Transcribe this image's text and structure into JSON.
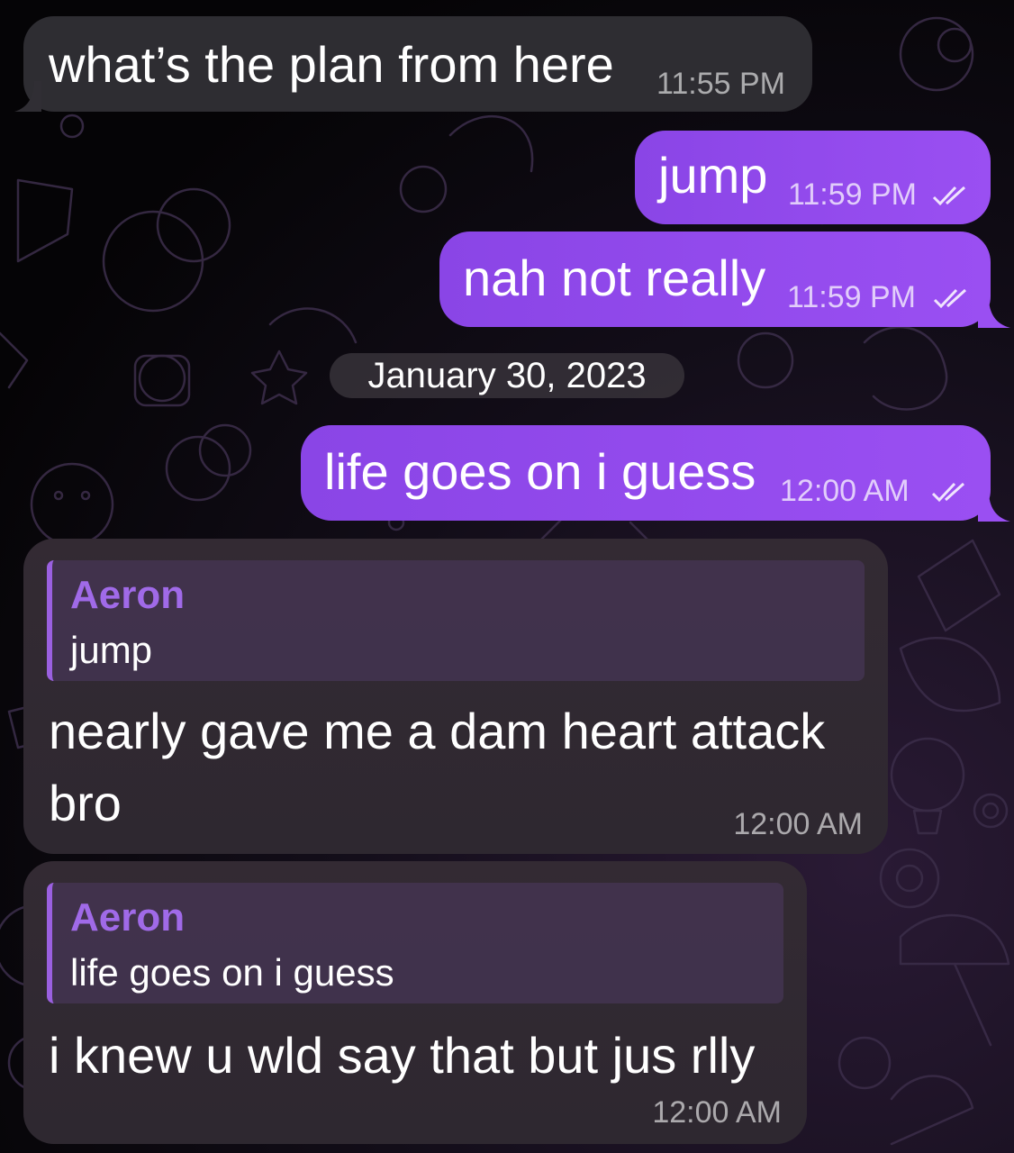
{
  "messages": [
    {
      "side": "incoming",
      "text": "what’s the plan from here",
      "time": "11:55 PM"
    },
    {
      "side": "outgoing",
      "text": "jump",
      "time": "11:59 PM",
      "read": true
    },
    {
      "side": "outgoing",
      "text": "nah not really",
      "time": "11:59 PM",
      "read": true
    },
    {
      "side": "outgoing",
      "text": "life goes on i guess",
      "time": "12:00 AM",
      "read": true
    },
    {
      "side": "incoming",
      "reply": {
        "author": "Aeron",
        "text": "jump"
      },
      "text_lines": [
        "nearly gave me a dam heart attack",
        "bro"
      ],
      "time": "12:00 AM"
    },
    {
      "side": "incoming",
      "reply": {
        "author": "Aeron",
        "text": "life goes on i guess"
      },
      "text": "i knew u wld say that but jus rlly",
      "time": "12:00 AM"
    }
  ],
  "date_divider": "January 30, 2023",
  "colors": {
    "outgoing_bubble": "#9a4ff2",
    "incoming_bubble": "#302e34",
    "reply_accent": "#a06ae8",
    "background": "#050406"
  },
  "icons": {
    "read_receipt": "double-check-icon"
  }
}
